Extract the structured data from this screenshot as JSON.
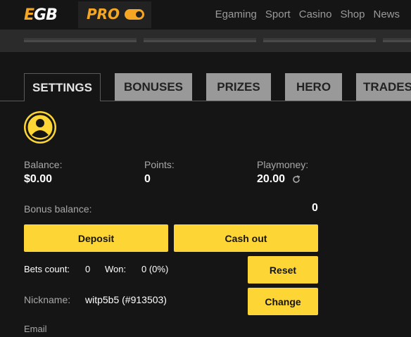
{
  "header": {
    "logo_e": "E",
    "logo_gb": "GB",
    "pro_label": "PRO",
    "nav": [
      "Egaming",
      "Sport",
      "Casino",
      "Shop",
      "News"
    ]
  },
  "tabs": [
    "SETTINGS",
    "BONUSES",
    "PRIZES",
    "HERO",
    "TRADES"
  ],
  "active_tab": "SETTINGS",
  "profile": {
    "balance_label": "Balance:",
    "balance_value": "$0.00",
    "points_label": "Points:",
    "points_value": "0",
    "playmoney_label": "Playmoney:",
    "playmoney_value": "20.00",
    "bonus_label": "Bonus balance:",
    "bonus_value": "0",
    "deposit_button": "Deposit",
    "cashout_button": "Cash out",
    "bets_count_label": "Bets count:",
    "bets_count_value": "0",
    "won_label": "Won:",
    "won_value": "0 (0%)",
    "reset_button": "Reset",
    "nickname_label": "Nickname:",
    "nickname_value": "witp5b5 (#913503)",
    "change_button": "Change",
    "email_label": "Email"
  },
  "colors": {
    "accent": "#fdd535",
    "brand_orange": "#f5a623",
    "background": "#151515",
    "tab_inactive": "#999999"
  },
  "icons": [
    "avatar-icon",
    "refresh-icon",
    "toggle-icon"
  ]
}
